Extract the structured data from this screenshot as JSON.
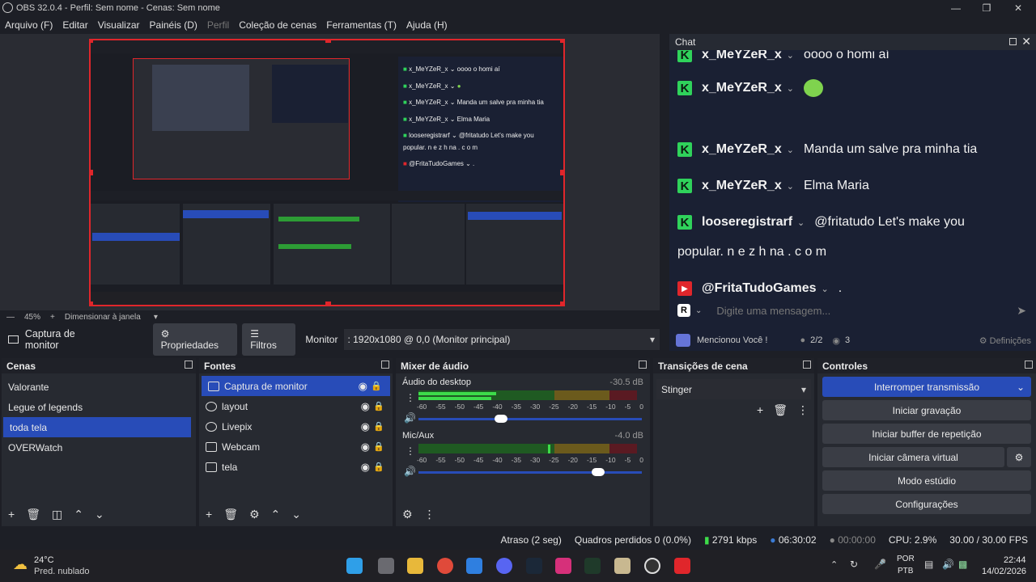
{
  "window": {
    "title": "OBS 32.0.4 - Perfil: Sem nome - Cenas: Sem nome"
  },
  "menu": [
    {
      "label": "Arquivo (F)",
      "disabled": false
    },
    {
      "label": "Editar",
      "disabled": false
    },
    {
      "label": "Visualizar",
      "disabled": false
    },
    {
      "label": "Painéis (D)",
      "disabled": false
    },
    {
      "label": "Perfil",
      "disabled": true
    },
    {
      "label": "Coleção de cenas",
      "disabled": false
    },
    {
      "label": "Ferramentas (T)",
      "disabled": false
    },
    {
      "label": "Ajuda (H)",
      "disabled": false
    }
  ],
  "zoom": {
    "value": "45%",
    "mode": "Dimensionar à janela"
  },
  "source_bar": {
    "source": "Captura de monitor",
    "properties": "Propriedades",
    "filters": "Filtros",
    "monitor_label": "Monitor",
    "monitor_value": ": 1920x1080 @ 0,0 (Monitor principal)"
  },
  "chat": {
    "title": "Chat",
    "messages": [
      {
        "user": "x_MeYZeR_x",
        "text": "oooo o homi aí",
        "platform": "kick"
      },
      {
        "user": "x_MeYZeR_x",
        "text": "",
        "platform": "kick",
        "emote": "green-blob"
      },
      {
        "user": "x_MeYZeR_x",
        "text": "Manda um salve pra minha tia",
        "platform": "kick"
      },
      {
        "user": "x_MeYZeR_x",
        "text": "Elma Maria",
        "platform": "kick"
      },
      {
        "user": "looseregistrarf",
        "text": "@fritatudo Let's make you",
        "platform": "kick",
        "cont": "popular. n e z h  na . c o m"
      },
      {
        "user": "@FritaTudoGames",
        "text": ".",
        "platform": "youtube"
      }
    ],
    "input_placeholder": "Digite uma mensagem...",
    "mention": "Mencionou Você !",
    "count1": "2/2",
    "count2": "3",
    "settings": "Definições"
  },
  "docks": {
    "scenes": {
      "title": "Cenas",
      "items": [
        "Valorante",
        "Legue of legends",
        "toda tela",
        "OVERWatch"
      ],
      "selected": 2
    },
    "sources": {
      "title": "Fontes",
      "items": [
        "Captura de monitor",
        "layout",
        "Livepix",
        "Webcam",
        "tela"
      ],
      "selected": 0
    },
    "mixer": {
      "title": "Mixer de áudio",
      "channels": [
        {
          "name": "Áudio do desktop",
          "db": "-30.5 dB",
          "level": 0.6,
          "volume": 0.4
        },
        {
          "name": "Mic/Aux",
          "db": "-4.0 dB",
          "level": 0.6,
          "volume": 0.8
        }
      ],
      "ticks": [
        "-60",
        "-55",
        "-50",
        "-45",
        "-40",
        "-35",
        "-30",
        "-25",
        "-20",
        "-15",
        "-10",
        "-5",
        "0"
      ]
    },
    "transitions": {
      "title": "Transições de cena",
      "value": "Stinger"
    },
    "controls": {
      "title": "Controles",
      "buttons": [
        "Interromper transmissão",
        "Iniciar gravação",
        "Iniciar buffer de repetição",
        "Iniciar câmera virtual",
        "Modo estúdio",
        "Configurações"
      ]
    }
  },
  "status": {
    "delay": "Atraso (2 seg)",
    "dropped": "Quadros perdidos 0 (0.0%)",
    "bitrate": "2791 kbps",
    "stream_time": "06:30:02",
    "rec_time": "00:00:00",
    "cpu": "CPU: 2.9%",
    "fps": "30.00 / 30.00 FPS"
  },
  "taskbar": {
    "weather_temp": "24°C",
    "weather_desc": "Pred. nublado",
    "lang1": "POR",
    "lang2": "PTB",
    "time": "22:44",
    "date": "14/02/2026"
  },
  "colors": {
    "accent": "#284cb8",
    "preview_border": "#e0262b",
    "kick": "#2fd25b"
  }
}
